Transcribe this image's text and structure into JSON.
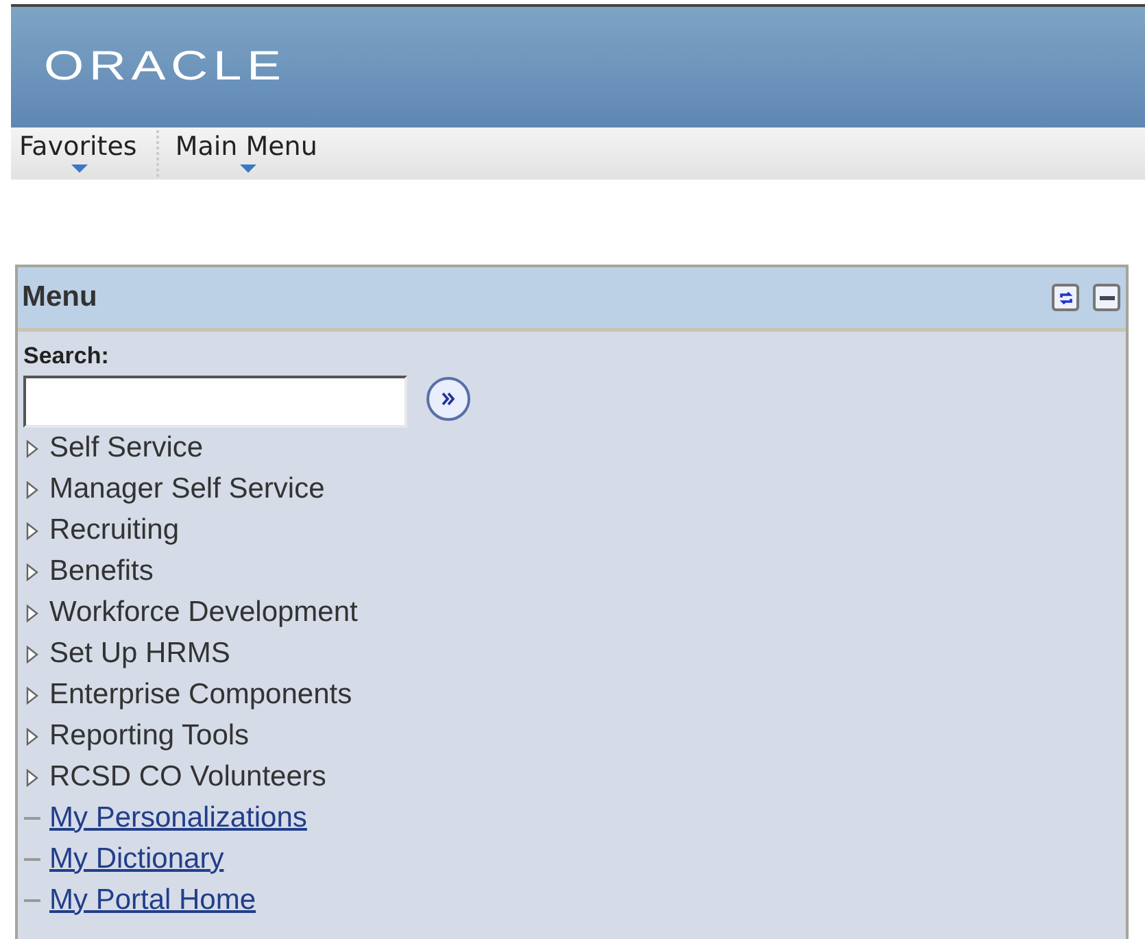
{
  "header": {
    "logo": "ORACLE"
  },
  "nav": [
    {
      "label": "Favorites"
    },
    {
      "label": "Main Menu"
    }
  ],
  "panel": {
    "title": "Menu",
    "search_label": "Search:",
    "items": [
      {
        "label": "Self Service",
        "kind": "folder"
      },
      {
        "label": "Manager Self Service",
        "kind": "folder"
      },
      {
        "label": "Recruiting",
        "kind": "folder"
      },
      {
        "label": "Benefits",
        "kind": "folder"
      },
      {
        "label": "Workforce Development",
        "kind": "folder"
      },
      {
        "label": "Set Up HRMS",
        "kind": "folder"
      },
      {
        "label": "Enterprise Components",
        "kind": "folder"
      },
      {
        "label": "Reporting Tools",
        "kind": "folder"
      },
      {
        "label": "RCSD CO Volunteers",
        "kind": "folder"
      },
      {
        "label": "My Personalizations",
        "kind": "link"
      },
      {
        "label": "My Dictionary",
        "kind": "link"
      },
      {
        "label": "My Portal Home",
        "kind": "link"
      }
    ]
  }
}
